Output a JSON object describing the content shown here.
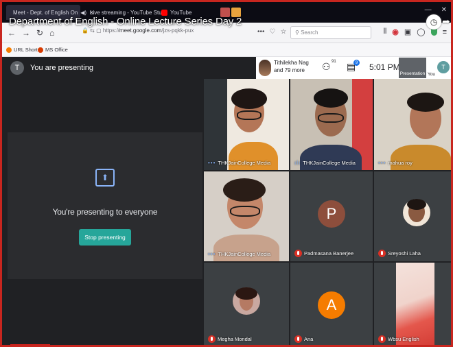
{
  "browser": {
    "window_title": "Department of English - Online Lecture Series Day 2",
    "tabs": [
      {
        "label": "Meet - Dept. of English On",
        "color": "#00897b"
      },
      {
        "label": "Live streaming - YouTube Stu",
        "color": "#ff0000"
      },
      {
        "label": "YouTube",
        "color": "#ff0000"
      }
    ],
    "url_prefix": "https://",
    "url_domain": "meet.google.com",
    "url_path": "/jzs-pqkk-pux",
    "search_placeholder": "Search",
    "bookmarks": [
      {
        "label": "URL Short",
        "color": "#f57c00"
      },
      {
        "label": "MS Office",
        "color": "#d83b01"
      }
    ]
  },
  "meet": {
    "presenting_label": "You are presenting",
    "user_initial": "T",
    "present_message": "You're presenting to everyone",
    "stop_button": "Stop presenting",
    "header": {
      "names_line1": "Tithilekha Nag",
      "names_line2": "and 79 more",
      "participants_count": "91",
      "chat_badge": "9",
      "time": "5:01 PM",
      "presentation_label": "Presentation",
      "you_label": "You",
      "avatar_initial": "T"
    },
    "tiles": [
      {
        "name": "THKJainCollege Media"
      },
      {
        "name": "THKJainCollege Media"
      },
      {
        "name": "mahua roy"
      },
      {
        "name": "THKJainCollege Media"
      },
      {
        "name": "Padmasana Banerjee",
        "initial": "P",
        "avatar_color": "#8d4e3c"
      },
      {
        "name": "Sreyoshi Laha"
      },
      {
        "name": "Megha Mondal"
      },
      {
        "name": "Ana",
        "initial": "A",
        "avatar_color": "#f57c00"
      },
      {
        "name": "Wbsu English"
      }
    ]
  }
}
